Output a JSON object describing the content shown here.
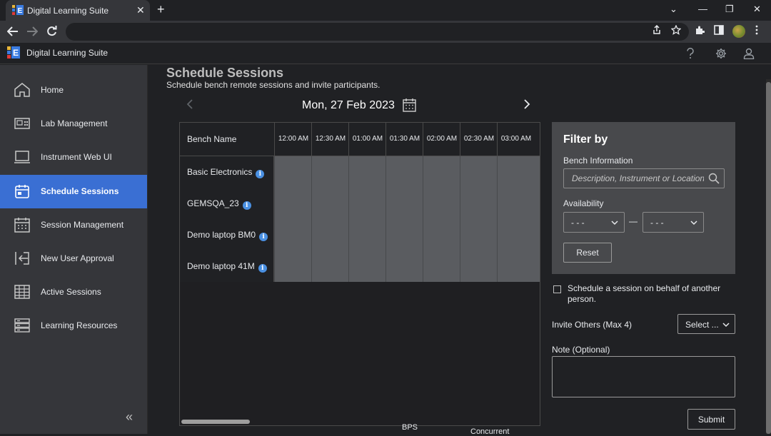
{
  "browser": {
    "tab_title": "Digital Learning Suite",
    "tab_close": "✕",
    "new_tab": "+",
    "window_controls": [
      "⌄",
      "—",
      "❐",
      "✕"
    ]
  },
  "app": {
    "title": "Digital Learning Suite",
    "header_icons": [
      "help-icon",
      "gear-icon",
      "user-icon"
    ]
  },
  "sidebar": {
    "items": [
      {
        "label": "Home",
        "icon": "home-icon"
      },
      {
        "label": "Lab Management",
        "icon": "lab-icon"
      },
      {
        "label": "Instrument Web UI",
        "icon": "monitor-icon"
      },
      {
        "label": "Schedule Sessions",
        "icon": "calendar-icon",
        "active": true
      },
      {
        "label": "Session Management",
        "icon": "calendar-grid-icon"
      },
      {
        "label": "New User Approval",
        "icon": "login-arrow-icon"
      },
      {
        "label": "Active Sessions",
        "icon": "table-icon"
      },
      {
        "label": "Learning Resources",
        "icon": "server-icon"
      }
    ],
    "collapse_glyph": "«"
  },
  "page": {
    "title": "Schedule Sessions",
    "subtitle": "Schedule bench remote sessions and invite participants.",
    "date": "Mon, 27 Feb 2023"
  },
  "grid": {
    "header": "Bench Name",
    "times": [
      "12:00 AM",
      "12:30 AM",
      "01:00 AM",
      "01:30 AM",
      "02:00 AM",
      "02:30 AM",
      "03:00 AM"
    ],
    "benches": [
      "Basic Electronics",
      "GEMSQA_23",
      "Demo laptop BM0",
      "Demo laptop 41M"
    ],
    "info_glyph": "i"
  },
  "filter": {
    "title": "Filter by",
    "bench_info_label": "Bench Information",
    "search_placeholder": "Description, Instrument or Location",
    "availability_label": "Availability",
    "availability_from": "- - -",
    "availability_to": "- - -",
    "dash": "—",
    "reset_label": "Reset"
  },
  "form": {
    "behalf_label": "Schedule a session on behalf of another person.",
    "invite_label": "Invite Others (Max 4)",
    "invite_select": "Select ...",
    "note_label": "Note (Optional)",
    "submit_label": "Submit"
  },
  "cutoff": {
    "text1": "BPS",
    "text2": "Concurrent"
  },
  "colors": {
    "accent": "#3a6fd3",
    "slot": "#5a5c60",
    "panel": "#48494c",
    "info": "#4a90e2"
  }
}
